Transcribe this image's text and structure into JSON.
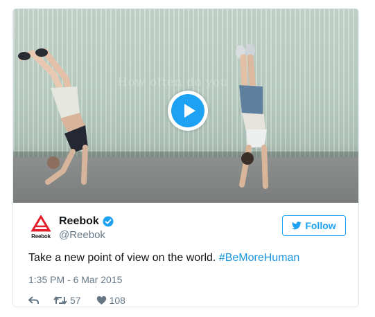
{
  "tweet": {
    "author_name": "Reebok",
    "handle": "@Reebok",
    "logo_word": "Reebok",
    "follow_label": "Follow",
    "text_main": "Take a new point of view on the world. ",
    "hashtag": "#BeMoreHuman",
    "timestamp": "1:35 PM - 6 Mar 2015",
    "retweets": "57",
    "likes": "108"
  },
  "media": {
    "watermark": "How often do you"
  },
  "colors": {
    "accent": "#1da1f2",
    "hashtag": "#1b95e0",
    "muted": "#657786",
    "brand_red": "#e41e2b"
  },
  "icons": {
    "verified": "verified-badge-icon",
    "play": "play-icon",
    "follow_bird": "bird-icon",
    "reply": "reply-icon",
    "retweet": "retweet-icon",
    "like": "heart-icon"
  }
}
